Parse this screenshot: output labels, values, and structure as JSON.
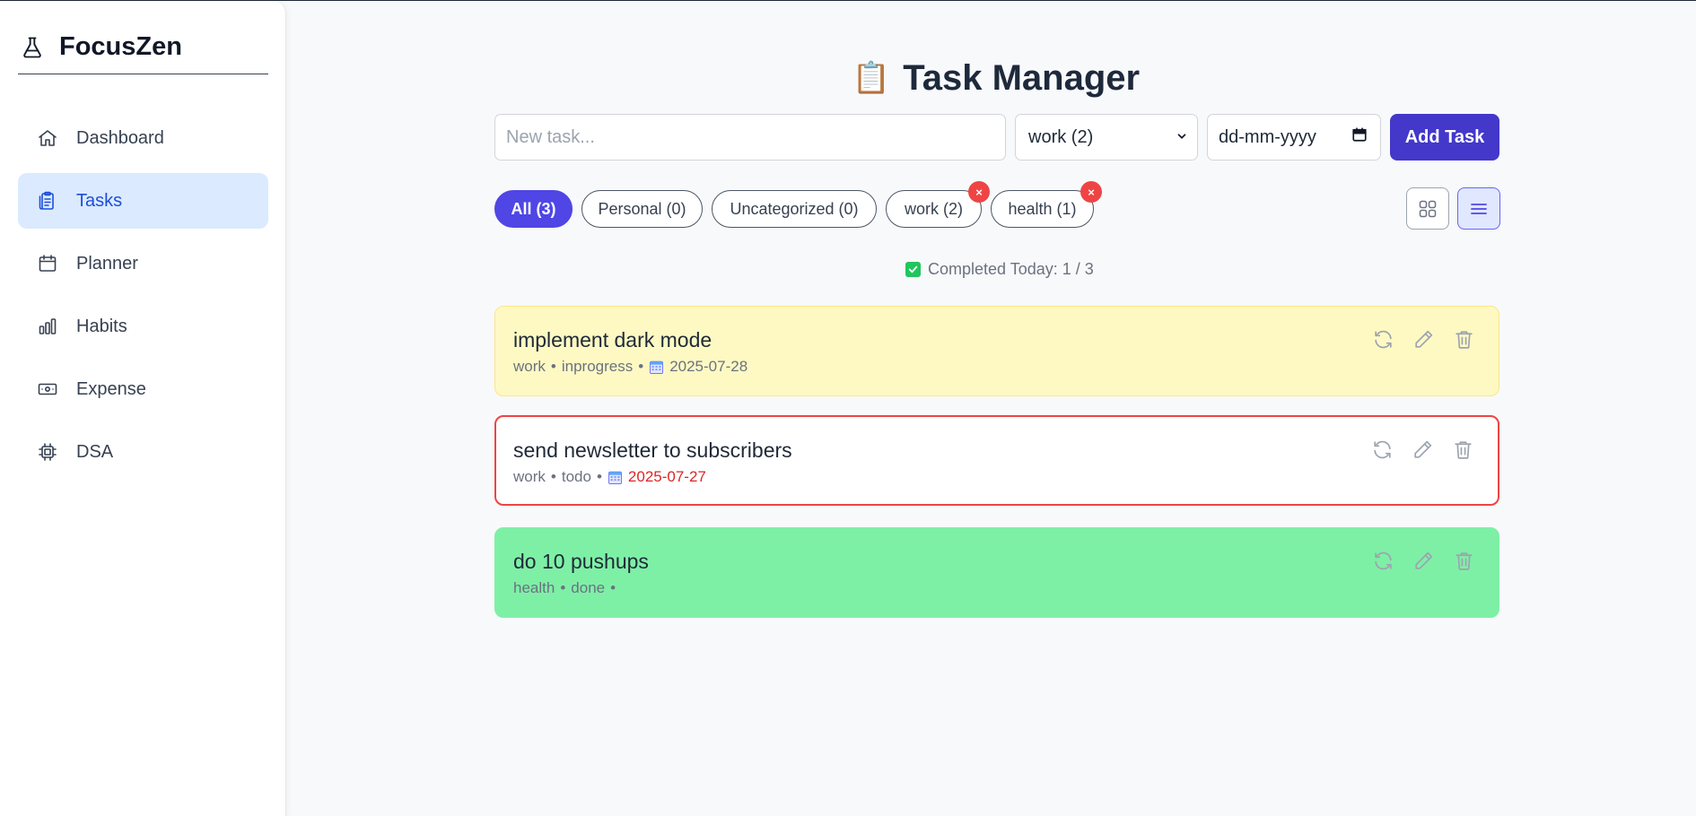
{
  "app": {
    "name": "FocusZen"
  },
  "sidebar": {
    "items": [
      {
        "label": "Dashboard",
        "icon": "home-icon"
      },
      {
        "label": "Tasks",
        "icon": "clipboard-icon",
        "active": true
      },
      {
        "label": "Planner",
        "icon": "calendar-icon"
      },
      {
        "label": "Habits",
        "icon": "bar-chart-icon"
      },
      {
        "label": "Expense",
        "icon": "cash-icon"
      },
      {
        "label": "DSA",
        "icon": "chip-icon"
      }
    ]
  },
  "header": {
    "title": "Task Manager",
    "emoji": "📋"
  },
  "form": {
    "task_placeholder": "New task...",
    "task_value": "",
    "category_selected": "work (2)",
    "date_placeholder": "dd-mm-yyyy",
    "add_label": "Add Task"
  },
  "filters": [
    {
      "label": "All (3)",
      "active": true
    },
    {
      "label": "Personal (0)"
    },
    {
      "label": "Uncategorized (0)"
    },
    {
      "label": "work (2)",
      "removable": true
    },
    {
      "label": "health (1)",
      "removable": true
    }
  ],
  "remove_symbol": "×",
  "view_toggle": {
    "grid": "grid-view-icon",
    "list": "list-view-icon",
    "active": "list"
  },
  "completed": {
    "text": "Completed Today: 1 / 3"
  },
  "tasks": [
    {
      "title": "implement dark mode",
      "category": "work",
      "status": "inprogress",
      "date": "2025-07-28",
      "overdue": false,
      "bg": "#fef9c3"
    },
    {
      "title": "send newsletter to subscribers",
      "category": "work",
      "status": "todo",
      "date": "2025-07-27",
      "overdue": true,
      "bg": "#ffffff"
    },
    {
      "title": "do 10 pushups",
      "category": "health",
      "status": "done",
      "date": "",
      "overdue": false,
      "bg": "#7ef0a6"
    }
  ],
  "separator": "•",
  "colors": {
    "accent": "#4f46e5",
    "active_nav_bg": "#dbeafe",
    "overdue": "#dc2626",
    "done": "#7ef0a6",
    "inprogress": "#fef9c3"
  }
}
